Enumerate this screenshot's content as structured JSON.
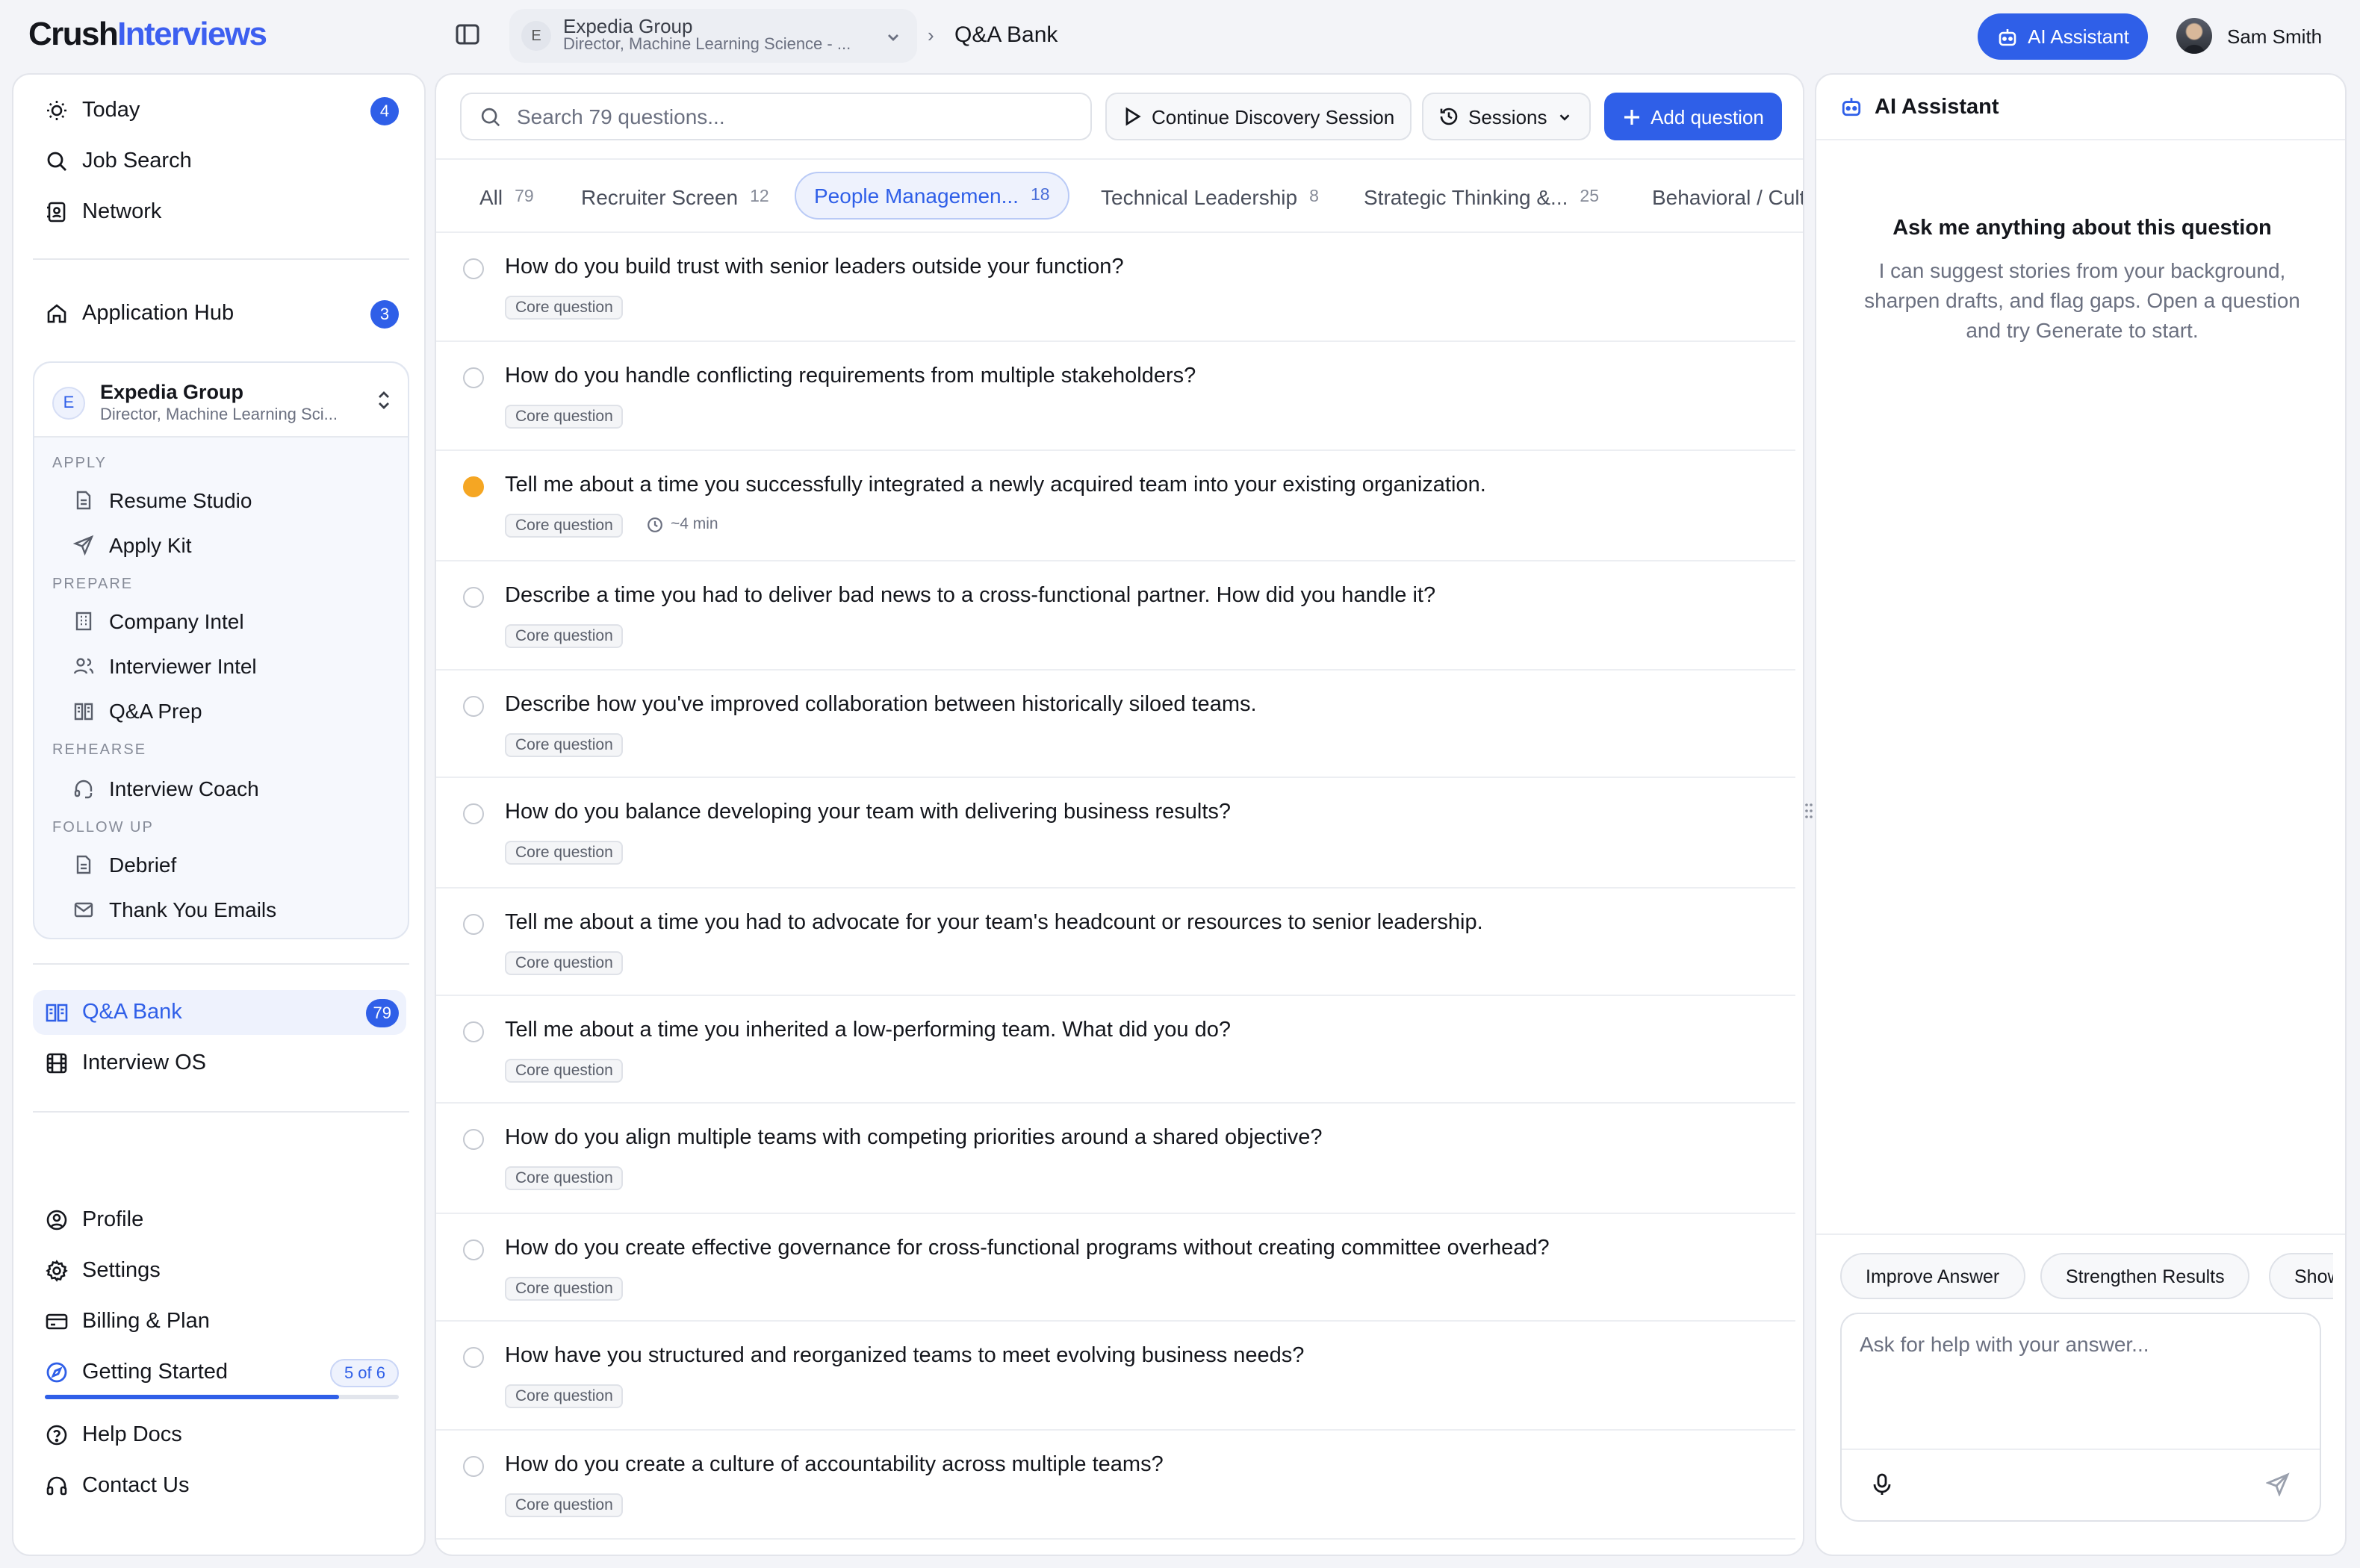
{
  "app": {
    "logo_main": "Crush",
    "logo_accent": "Interviews"
  },
  "header": {
    "job_initial": "E",
    "job_company": "Expedia Group",
    "job_title": "Director, Machine Learning Science - ...",
    "separator": "›",
    "page_title": "Q&A Bank",
    "ai_button": "AI Assistant",
    "user_name": "Sam Smith"
  },
  "sidebar": {
    "top_items": [
      {
        "label": "Today",
        "icon": "sun-icon",
        "badge": "4"
      },
      {
        "label": "Job Search",
        "icon": "search-icon"
      },
      {
        "label": "Network",
        "icon": "contacts-icon"
      }
    ],
    "hub": {
      "label": "Application Hub",
      "icon": "home-icon",
      "badge": "3"
    },
    "job_card": {
      "initial": "E",
      "company": "Expedia Group",
      "title": "Director, Machine Learning Sci..."
    },
    "sections": [
      {
        "label": "APPLY",
        "items": [
          {
            "label": "Resume Studio",
            "icon": "document-icon"
          },
          {
            "label": "Apply Kit",
            "icon": "send-icon"
          }
        ]
      },
      {
        "label": "PREPARE",
        "items": [
          {
            "label": "Company Intel",
            "icon": "building-icon"
          },
          {
            "label": "Interviewer Intel",
            "icon": "users-icon"
          },
          {
            "label": "Q&A Prep",
            "icon": "book-icon"
          }
        ]
      },
      {
        "label": "REHEARSE",
        "items": [
          {
            "label": "Interview Coach",
            "icon": "headset-icon"
          }
        ]
      },
      {
        "label": "FOLLOW UP",
        "items": [
          {
            "label": "Debrief",
            "icon": "document-icon"
          },
          {
            "label": "Thank You Emails",
            "icon": "mail-icon"
          }
        ]
      }
    ],
    "bank": {
      "label": "Q&A Bank",
      "icon": "book-icon",
      "badge": "79"
    },
    "os": {
      "label": "Interview OS",
      "icon": "film-icon"
    },
    "bottom_items": [
      {
        "label": "Profile",
        "icon": "user-circle-icon"
      },
      {
        "label": "Settings",
        "icon": "gear-icon"
      },
      {
        "label": "Billing & Plan",
        "icon": "card-icon"
      }
    ],
    "getting_started": {
      "label": "Getting Started",
      "icon": "compass-icon",
      "progress_text": "5 of 6",
      "progress": 0.83
    },
    "help_items": [
      {
        "label": "Help Docs",
        "icon": "help-icon"
      },
      {
        "label": "Contact Us",
        "icon": "headphones-icon"
      }
    ]
  },
  "toolbar": {
    "search_placeholder": "Search 79 questions...",
    "continue_label": "Continue Discovery Session",
    "sessions_label": "Sessions",
    "add_label": "Add question"
  },
  "tabs": [
    {
      "label": "All",
      "count": "79"
    },
    {
      "label": "Recruiter Screen",
      "count": "12"
    },
    {
      "label": "People Managemen...",
      "count": "18",
      "active": true
    },
    {
      "label": "Technical Leadership",
      "count": "8"
    },
    {
      "label": "Strategic Thinking &...",
      "count": "25"
    },
    {
      "label": "Behavioral / Culture",
      "count": ""
    }
  ],
  "questions": [
    {
      "text": "How do you build trust with senior leaders outside your function?",
      "tag": "Core question"
    },
    {
      "text": "How do you handle conflicting requirements from multiple stakeholders?",
      "tag": "Core question"
    },
    {
      "text": "Tell me about a time you successfully integrated a newly acquired team into your existing organization.",
      "tag": "Core question",
      "time": "~4 min",
      "active": true
    },
    {
      "text": "Describe a time you had to deliver bad news to a cross-functional partner. How did you handle it?",
      "tag": "Core question"
    },
    {
      "text": "Describe how you've improved collaboration between historically siloed teams.",
      "tag": "Core question"
    },
    {
      "text": "How do you balance developing your team with delivering business results?",
      "tag": "Core question"
    },
    {
      "text": "Tell me about a time you had to advocate for your team's headcount or resources to senior leadership.",
      "tag": "Core question"
    },
    {
      "text": "Tell me about a time you inherited a low-performing team. What did you do?",
      "tag": "Core question"
    },
    {
      "text": "How do you align multiple teams with competing priorities around a shared objective?",
      "tag": "Core question"
    },
    {
      "text": "How do you create effective governance for cross-functional programs without creating committee overhead?",
      "tag": "Core question"
    },
    {
      "text": "How have you structured and reorganized teams to meet evolving business needs?",
      "tag": "Core question"
    },
    {
      "text": "How do you create a culture of accountability across multiple teams?",
      "tag": "Core question"
    }
  ],
  "ai_panel": {
    "title": "AI Assistant",
    "empty_title": "Ask me anything about this question",
    "empty_desc": "I can suggest stories from your background, sharpen drafts, and flag gaps. Open a question and try Generate to start.",
    "chips": [
      "Improve Answer",
      "Strengthen Results",
      "Show"
    ],
    "input_placeholder": "Ask for help with your answer..."
  },
  "colors": {
    "accent": "#2f5fe8",
    "active_dot": "#f5a623"
  }
}
